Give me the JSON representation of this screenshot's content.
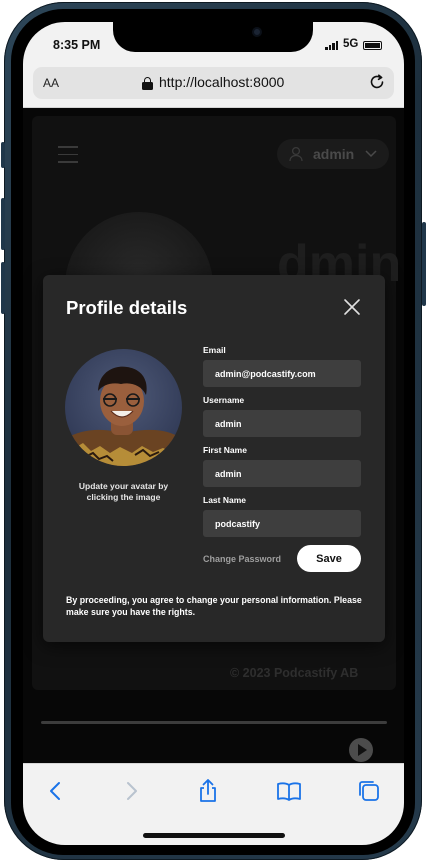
{
  "status_bar": {
    "time": "8:35 PM",
    "network": "5G"
  },
  "browser": {
    "text_size_label": "AA",
    "url": "http://localhost:8000"
  },
  "header": {
    "username": "admin"
  },
  "background": {
    "partial_text": "dmin",
    "copyright": "© 2023 Podcastify AB"
  },
  "modal": {
    "title": "Profile details",
    "avatar_caption": "Update your avatar by clicking the image",
    "fields": {
      "email": {
        "label": "Email",
        "value": "admin@podcastify.com"
      },
      "username": {
        "label": "Username",
        "value": "admin"
      },
      "first_name": {
        "label": "First Name",
        "value": "admin"
      },
      "last_name": {
        "label": "Last Name",
        "value": "podcastify"
      }
    },
    "change_password_label": "Change Password",
    "save_label": "Save",
    "consent_text": "By proceeding, you agree to change your personal information. Please make sure you have the rights."
  },
  "icons": {
    "back": "chevron-left-icon",
    "forward": "chevron-right-icon",
    "share": "share-icon",
    "bookmarks": "book-icon",
    "tabs": "tabs-icon"
  },
  "colors": {
    "accent_blue": "#1a73e8",
    "modal_bg": "#282828",
    "input_bg": "#3e3e3e"
  }
}
